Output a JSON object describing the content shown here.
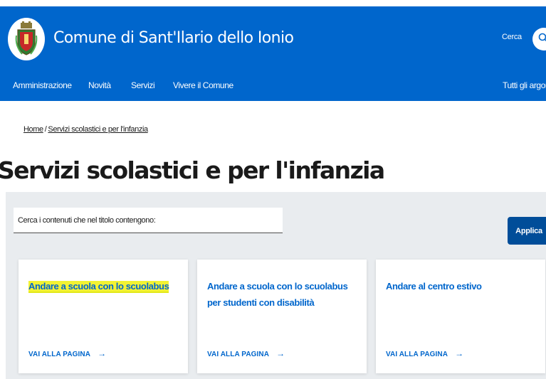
{
  "header": {
    "site_title": "Comune di Sant'Ilario dello Ionio",
    "search_label": "Cerca",
    "search_icon": "search-icon",
    "logo_icon": "municipal-crest"
  },
  "nav": {
    "items": [
      "Amministrazione",
      "Novità",
      "Servizi",
      "Vivere il Comune"
    ],
    "right_item": "Tutti gli argom"
  },
  "breadcrumb": {
    "home": "Home",
    "separator": "/",
    "current": "Servizi scolastici e per l'infanzia"
  },
  "page": {
    "title": "Servizi scolastici e per l'infanzia"
  },
  "filter": {
    "label": "Cerca i contenuti che nel titolo contengono:",
    "apply_label": "Applica"
  },
  "cards": [
    {
      "title": "Andare a scuola con lo scuolabus",
      "link": "VAI ALLA PAGINA",
      "arrow": "→"
    },
    {
      "title": "Andare a scuola con lo scuolabus per studenti con disabilità",
      "link": "VAI ALLA PAGINA",
      "arrow": "→"
    },
    {
      "title": "Andare al centro estivo",
      "link": "VAI ALLA PAGINA",
      "arrow": "→"
    }
  ],
  "colors": {
    "brand_blue": "#0066cc",
    "apply_button": "#004d99",
    "panel_gray": "#e9ecef",
    "highlight": "#f2f233"
  }
}
